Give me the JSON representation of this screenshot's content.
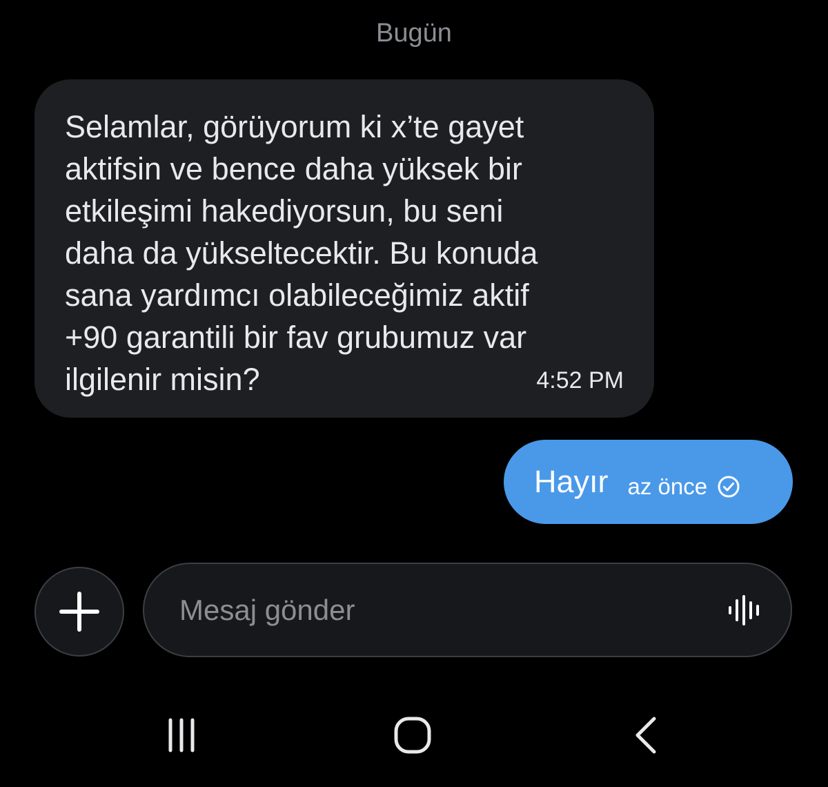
{
  "conversation": {
    "date_label": "Bugün",
    "messages": [
      {
        "direction": "incoming",
        "text": "Selamlar, görüyorum ki x’te gayet\naktifsin ve bence daha yüksek bir\netkileşimi hakediyorsun, bu seni\ndaha da yükseltecektir. Bu konuda\nsana yardımcı olabileceğimiz aktif\n+90 garantili bir fav grubumuz var\nilgilenir misin?",
        "time": "4:52 PM"
      },
      {
        "direction": "outgoing",
        "text": "Hayır",
        "time": "az önce",
        "status_icon": "check-circle-icon"
      }
    ]
  },
  "composer": {
    "add_icon": "plus-icon",
    "placeholder": "Mesaj gönder",
    "voice_icon": "voice-waveform-icon"
  },
  "navbar": {
    "recent_icon": "recent-apps-icon",
    "home_icon": "home-icon",
    "back_icon": "back-icon"
  },
  "colors": {
    "background": "#000000",
    "incoming_bubble": "#1d1f23",
    "outgoing_bubble": "#4a99e9",
    "muted_text": "#8b8f94"
  }
}
